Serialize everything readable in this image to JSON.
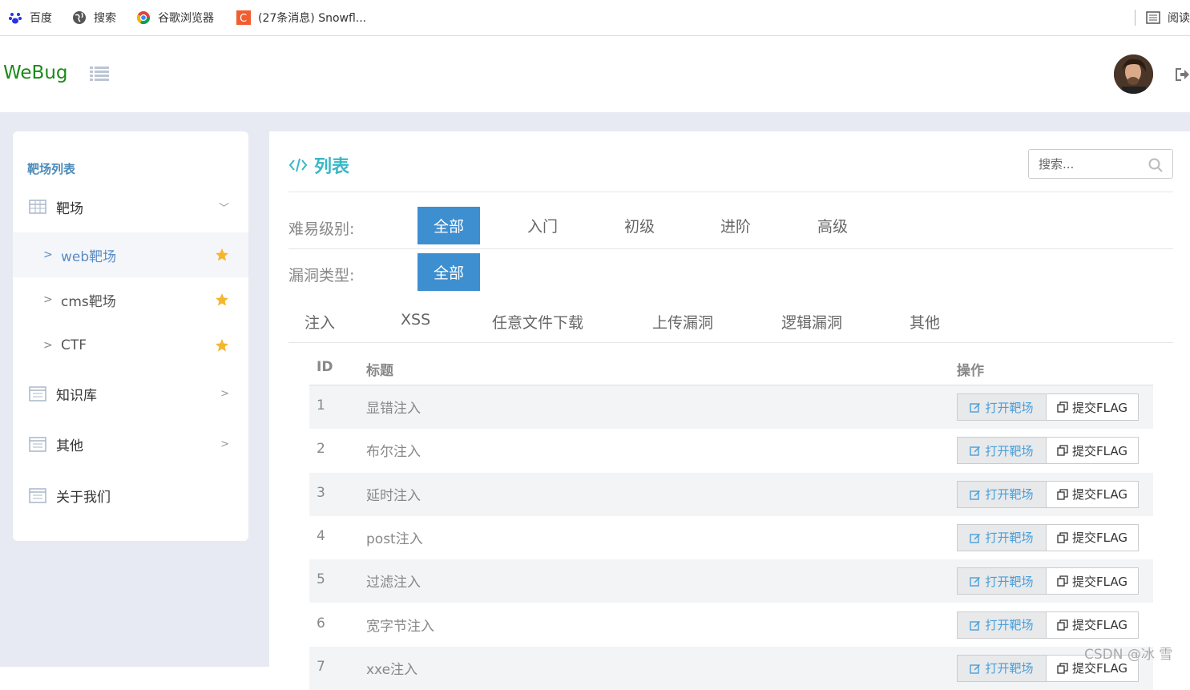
{
  "bookmarks": [
    {
      "label": "百度",
      "icon": "baidu-icon"
    },
    {
      "label": "搜索",
      "icon": "globe-icon"
    },
    {
      "label": "谷歌浏览器",
      "icon": "chrome-icon"
    },
    {
      "label": "(27条消息) Snowfl...",
      "icon": "csdn-icon"
    }
  ],
  "reading_label": "阅读",
  "header": {
    "logo": "WeBug"
  },
  "sidebar": {
    "title": "靶场列表",
    "group_label": "靶场",
    "sub_items": [
      {
        "label": "web靶场"
      },
      {
        "label": "cms靶场"
      },
      {
        "label": "CTF"
      }
    ],
    "items": [
      {
        "label": "知识库"
      },
      {
        "label": "其他"
      },
      {
        "label": "关于我们"
      }
    ]
  },
  "main": {
    "title": "列表",
    "search_placeholder": "搜索...",
    "difficulty_label": "难易级别:",
    "difficulty": [
      "全部",
      "入门",
      "初级",
      "进阶",
      "高级"
    ],
    "vuln_label": "漏洞类型:",
    "vuln_all": "全部",
    "vuln_types": [
      "注入",
      "XSS",
      "任意文件下载",
      "上传漏洞",
      "逻辑漏洞",
      "其他"
    ]
  },
  "table": {
    "headers": {
      "id": "ID",
      "title": "标题",
      "action": "操作"
    },
    "open_label": "打开靶场",
    "flag_label": "提交FLAG",
    "rows": [
      {
        "id": "1",
        "title": "显错注入"
      },
      {
        "id": "2",
        "title": "布尔注入"
      },
      {
        "id": "3",
        "title": "延时注入"
      },
      {
        "id": "4",
        "title": "post注入"
      },
      {
        "id": "5",
        "title": "过滤注入"
      },
      {
        "id": "6",
        "title": "宽字节注入"
      },
      {
        "id": "7",
        "title": "xxe注入"
      }
    ]
  },
  "watermark": "CSDN @冰 雪"
}
